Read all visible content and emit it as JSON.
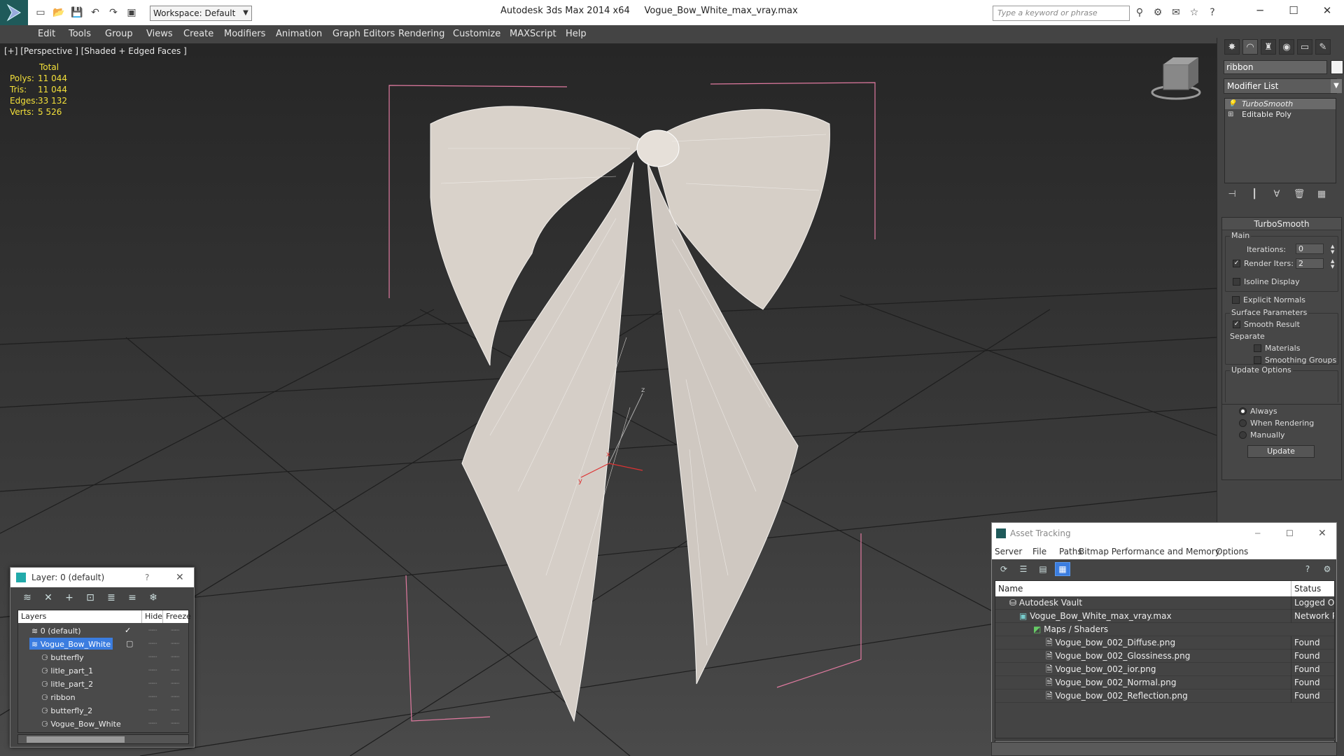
{
  "window": {
    "app_name": "Autodesk 3ds Max  2014 x64",
    "file_name": "Vogue_Bow_White_max_vray.max",
    "workspace": "Workspace: Default",
    "search_placeholder": "Type a keyword or phrase",
    "accent": "#1f5a5a"
  },
  "menu": [
    "Edit",
    "Tools",
    "Group",
    "Views",
    "Create",
    "Modifiers",
    "Animation",
    "Graph Editors",
    "Rendering",
    "Customize",
    "MAXScript",
    "Help"
  ],
  "viewport": {
    "label": "[+] [Perspective ] [Shaded + Edged Faces ]",
    "stats": {
      "header": "Total",
      "rows": [
        {
          "k": "Polys:",
          "v": "11 044"
        },
        {
          "k": "Tris:",
          "v": "11 044"
        },
        {
          "k": "Edges:",
          "v": "33 132"
        },
        {
          "k": "Verts:",
          "v": "5 526"
        }
      ]
    },
    "stats_color": "#f3e03a",
    "gizmo": {
      "x": "x",
      "y": "y",
      "z": "z"
    }
  },
  "command_panel": {
    "object_name": "ribbon",
    "modifier_list": "Modifier List",
    "stack": [
      {
        "name": "TurboSmooth",
        "selected": true
      },
      {
        "name": "Editable Poly",
        "selected": false
      }
    ],
    "turbosmooth": {
      "title": "TurboSmooth",
      "main": "Main",
      "iterations_label": "Iterations:",
      "iterations": "0",
      "render_iters_label": "Render Iters:",
      "render_iters": "2",
      "isoline": "Isoline Display",
      "explicit": "Explicit Normals",
      "surface": "Surface Parameters",
      "smooth_result": "Smooth Result",
      "separate": "Separate",
      "materials": "Materials",
      "smoothing": "Smoothing Groups",
      "update_options": "Update Options",
      "always": "Always",
      "when_rendering": "When Rendering",
      "manually": "Manually",
      "update": "Update"
    }
  },
  "layer_dialog": {
    "title": "Layer: 0 (default)",
    "help": "?",
    "col_layers": "Layers",
    "col_hide": "Hide",
    "col_freeze": "Freeze",
    "rows": [
      {
        "name": "0 (default)",
        "indent": 1,
        "selected": false
      },
      {
        "name": "Vogue_Bow_White",
        "indent": 1,
        "selected": true
      },
      {
        "name": "butterfly",
        "indent": 2,
        "selected": false
      },
      {
        "name": "litle_part_1",
        "indent": 2,
        "selected": false
      },
      {
        "name": "litle_part_2",
        "indent": 2,
        "selected": false
      },
      {
        "name": "ribbon",
        "indent": 2,
        "selected": false
      },
      {
        "name": "butterfly_2",
        "indent": 2,
        "selected": false
      },
      {
        "name": "Vogue_Bow_White",
        "indent": 2,
        "selected": false
      }
    ]
  },
  "asset_dialog": {
    "title": "Asset Tracking",
    "menu": [
      "Server",
      "File",
      "Paths",
      "Bitmap Performance and Memory",
      "Options"
    ],
    "col_name": "Name",
    "col_status": "Status",
    "rows": [
      {
        "name": "Autodesk Vault",
        "status": "Logged Ou",
        "indent": 1
      },
      {
        "name": "Vogue_Bow_White_max_vray.max",
        "status": "Network Pa",
        "indent": 2
      },
      {
        "name": "Maps / Shaders",
        "status": "",
        "indent": 3
      },
      {
        "name": "Vogue_bow_002_Diffuse.png",
        "status": "Found",
        "indent": 4
      },
      {
        "name": "Vogue_bow_002_Glossiness.png",
        "status": "Found",
        "indent": 4
      },
      {
        "name": "Vogue_bow_002_ior.png",
        "status": "Found",
        "indent": 4
      },
      {
        "name": "Vogue_bow_002_Normal.png",
        "status": "Found",
        "indent": 4
      },
      {
        "name": "Vogue_bow_002_Reflection.png",
        "status": "Found",
        "indent": 4
      }
    ]
  }
}
